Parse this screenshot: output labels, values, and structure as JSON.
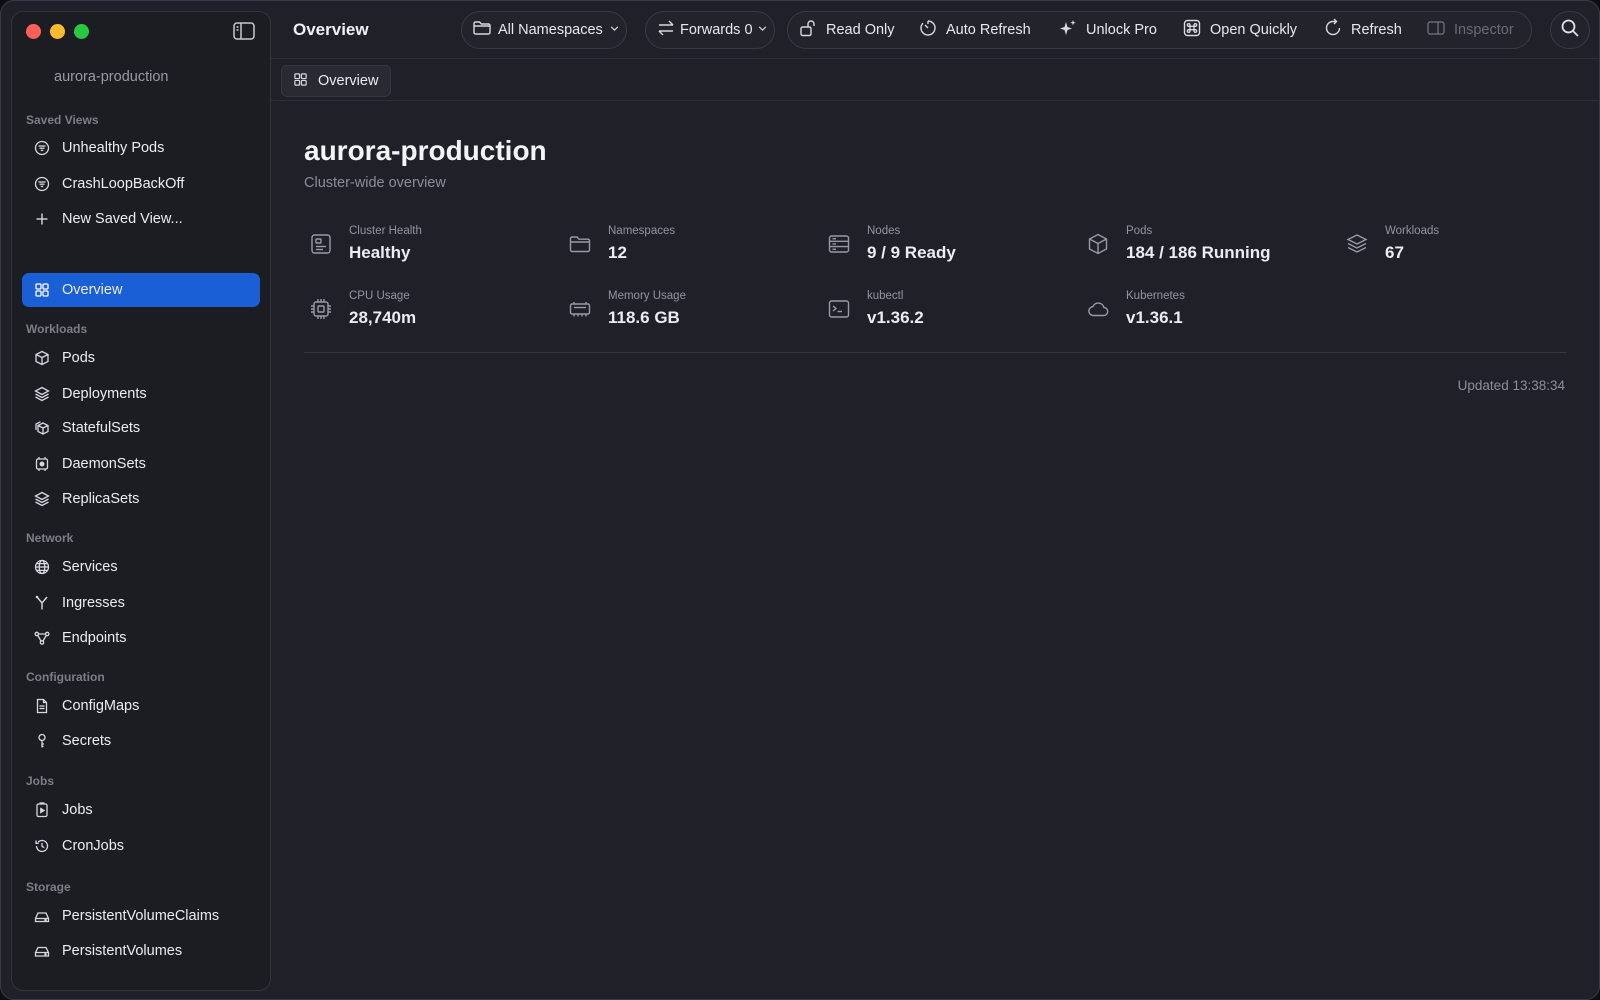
{
  "window": {
    "traffic_lights": {
      "close": "#fe5f57",
      "minimize": "#febc2e",
      "zoom": "#28c840"
    }
  },
  "sidebar": {
    "cluster_name": "aurora-production",
    "saved_views": {
      "label": "Saved Views",
      "items": [
        {
          "label": "Unhealthy Pods",
          "icon": "filter-icon"
        },
        {
          "label": "CrashLoopBackOff",
          "icon": "filter-icon"
        },
        {
          "label": "New Saved View...",
          "icon": "plus-icon"
        }
      ]
    },
    "overview": {
      "label": "Overview",
      "icon": "grid-icon",
      "active": true
    },
    "workloads": {
      "label": "Workloads",
      "items": [
        {
          "label": "Pods",
          "icon": "cube-icon"
        },
        {
          "label": "Deployments",
          "icon": "layers-icon"
        },
        {
          "label": "StatefulSets",
          "icon": "stacked-cubes-icon"
        },
        {
          "label": "DaemonSets",
          "icon": "daemon-icon"
        },
        {
          "label": "ReplicaSets",
          "icon": "layers-icon"
        }
      ]
    },
    "network": {
      "label": "Network",
      "items": [
        {
          "label": "Services",
          "icon": "globe-icon"
        },
        {
          "label": "Ingresses",
          "icon": "fork-icon"
        },
        {
          "label": "Endpoints",
          "icon": "nodes-icon"
        }
      ]
    },
    "configuration": {
      "label": "Configuration",
      "items": [
        {
          "label": "ConfigMaps",
          "icon": "document-icon"
        },
        {
          "label": "Secrets",
          "icon": "key-icon"
        }
      ]
    },
    "jobs": {
      "label": "Jobs",
      "items": [
        {
          "label": "Jobs",
          "icon": "play-doc-icon"
        },
        {
          "label": "CronJobs",
          "icon": "history-icon"
        }
      ]
    },
    "storage": {
      "label": "Storage",
      "items": [
        {
          "label": "PersistentVolumeClaims",
          "icon": "drive-link-icon"
        },
        {
          "label": "PersistentVolumes",
          "icon": "drive-icon"
        }
      ]
    }
  },
  "toolbar": {
    "title": "Overview",
    "namespace_selector": "All Namespaces",
    "forwards": "Forwards 0",
    "read_only": "Read Only",
    "auto_refresh": "Auto Refresh",
    "unlock_pro": "Unlock Pro",
    "open_quickly": "Open Quickly",
    "refresh": "Refresh",
    "inspector": "Inspector"
  },
  "tab": {
    "label": "Overview"
  },
  "main": {
    "title": "aurora-production",
    "subtitle": "Cluster-wide overview",
    "stats": [
      {
        "label": "Cluster Health",
        "value": "Healthy",
        "icon": "health-panel-icon"
      },
      {
        "label": "Namespaces",
        "value": "12",
        "icon": "folder-icon"
      },
      {
        "label": "Nodes",
        "value": "9 / 9 Ready",
        "icon": "server-icon"
      },
      {
        "label": "Pods",
        "value": "184 / 186 Running",
        "icon": "cube-icon"
      },
      {
        "label": "Workloads",
        "value": "67",
        "icon": "layers-icon"
      },
      {
        "label": "CPU Usage",
        "value": "28,740m",
        "icon": "cpu-icon"
      },
      {
        "label": "Memory Usage",
        "value": "118.6 GB",
        "icon": "memory-icon"
      },
      {
        "label": "kubectl",
        "value": "v1.36.2",
        "icon": "terminal-icon"
      },
      {
        "label": "Kubernetes",
        "value": "v1.36.1",
        "icon": "cloud-icon"
      }
    ],
    "updated": "Updated 13:38:34"
  },
  "colors": {
    "accent": "#1a5fd6",
    "background": "#202029",
    "sidebar": "#1c1c23"
  }
}
